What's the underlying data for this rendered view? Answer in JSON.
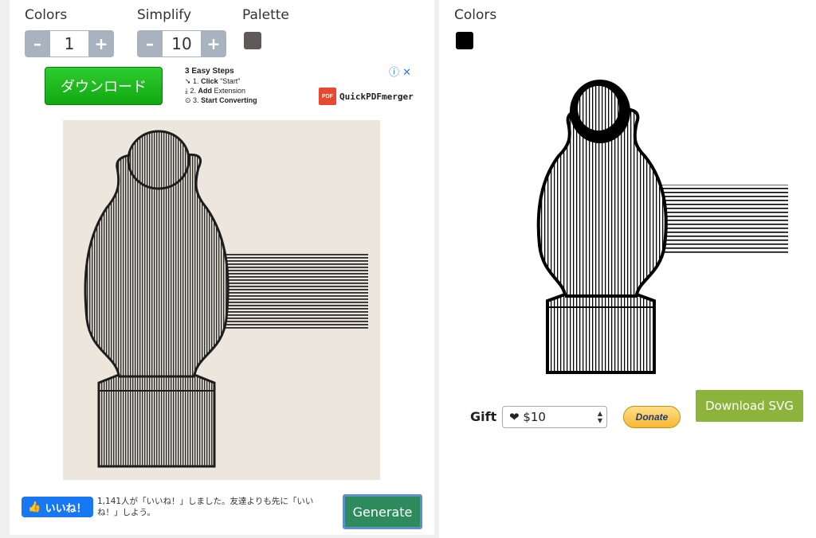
{
  "left_panel": {
    "colors": {
      "label": "Colors",
      "value": "1",
      "minus": "–",
      "plus": "+"
    },
    "simplify": {
      "label": "Simplify",
      "value": "10",
      "minus": "–",
      "plus": "+"
    },
    "palette": {
      "label": "Palette",
      "swatch_color": "#5f5a57"
    },
    "ad": {
      "download_label": "ダウンロード",
      "steps_title": "3 Easy Steps",
      "step1_num": "1.",
      "step1_bold": "Click",
      "step1_rest": "\"Start\"",
      "step2_num": "2.",
      "step2_bold": "Add",
      "step2_rest": "Extension",
      "step3_num": "3.",
      "step3_bold": "Start Converting",
      "brand": "QuickPDFmerger",
      "pdf_badge": "PDF"
    },
    "like": {
      "button_label": "いいね！",
      "text": "1,141人が「いいね！」しました。友達よりも先に「いいね！」しよう。"
    },
    "generate_label": "Generate"
  },
  "right_panel": {
    "colors": {
      "label": "Colors",
      "swatch_color": "#000000"
    },
    "download_label": "Download SVG",
    "gift": {
      "label": "Gift",
      "value": "❤ $10"
    },
    "donate_label": "Donate"
  }
}
